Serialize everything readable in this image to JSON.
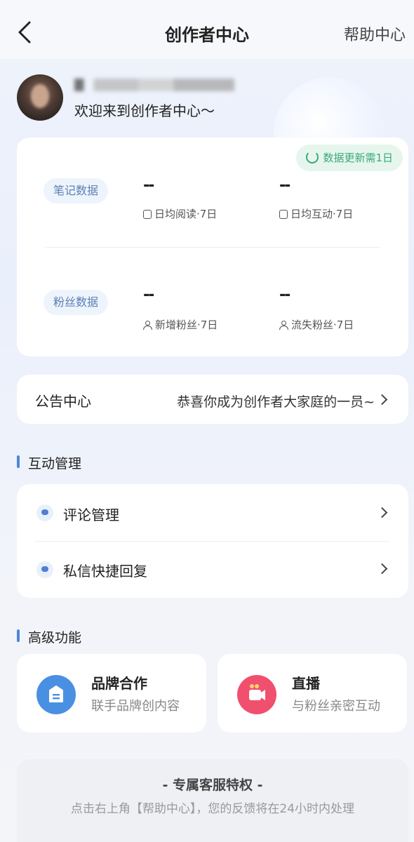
{
  "nav": {
    "title": "创作者中心",
    "right_link": "帮助中心"
  },
  "profile": {
    "welcome": "欢迎来到创作者中心～"
  },
  "data_panel": {
    "update_badge": "数据更新需1日",
    "note_section": {
      "pill": "笔记数据",
      "metrics": [
        {
          "value": "--",
          "label": "日均阅读·7日"
        },
        {
          "value": "--",
          "label": "日均互动·7日"
        }
      ]
    },
    "fans_section": {
      "pill": "粉丝数据",
      "metrics": [
        {
          "value": "--",
          "label": "新增粉丝·7日"
        },
        {
          "value": "--",
          "label": "流失粉丝·7日"
        }
      ]
    }
  },
  "notice": {
    "title": "公告中心",
    "text": "恭喜你成为创作者大家庭的一员~"
  },
  "interaction": {
    "heading": "互动管理",
    "items": [
      {
        "label": "评论管理"
      },
      {
        "label": "私信快捷回复"
      }
    ]
  },
  "advanced": {
    "heading": "高级功能",
    "features": [
      {
        "title": "品牌合作",
        "subtitle": "联手品牌创内容",
        "icon": "brand-icon",
        "color": "#4a90e2"
      },
      {
        "title": "直播",
        "subtitle": "与粉丝亲密互动",
        "icon": "live-icon",
        "color": "#f0506e"
      }
    ]
  },
  "service": {
    "title": "- 专属客服特权 -",
    "text": "点击右上角【帮助中心】，您的反馈将在24小时内处理"
  },
  "colors": {
    "accent": "#4f86d8",
    "update_green": "#3aa97a",
    "pill_text": "#5b7fb5"
  }
}
